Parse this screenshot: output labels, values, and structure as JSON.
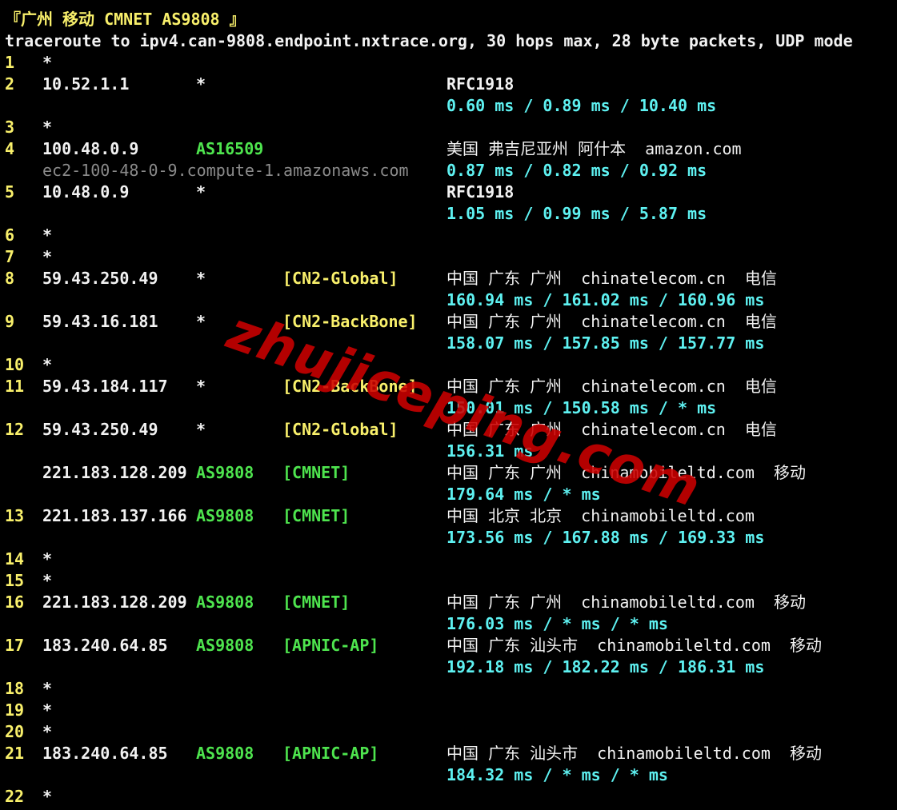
{
  "header": {
    "title": "『广州 移动 CMNET AS9808 』",
    "command": "traceroute to ipv4.can-9808.endpoint.nxtrace.org, 30 hops max, 28 byte packets, UDP mode"
  },
  "hops": [
    {
      "hop": "1",
      "ip": "*"
    },
    {
      "hop": "2",
      "ip": "10.52.1.1",
      "asn": "*",
      "geo": "RFC1918",
      "rtt": "0.60 ms / 0.89 ms / 10.40 ms"
    },
    {
      "hop": "3",
      "ip": "*"
    },
    {
      "hop": "4",
      "ip": "100.48.0.9",
      "asn": "AS16509",
      "geo": "美国 弗吉尼亚州 阿什本  amazon.com",
      "hostname": "ec2-100-48-0-9.compute-1.amazonaws.com",
      "rtt": "0.87 ms / 0.82 ms / 0.92 ms"
    },
    {
      "hop": "5",
      "ip": "10.48.0.9",
      "asn": "*",
      "geo": "RFC1918",
      "rtt": "1.05 ms / 0.99 ms / 5.87 ms"
    },
    {
      "hop": "6",
      "ip": "*"
    },
    {
      "hop": "7",
      "ip": "*"
    },
    {
      "hop": "8",
      "ip": "59.43.250.49",
      "asn": "*",
      "tag": "[CN2-Global]",
      "geo": "中国 广东 广州  chinatelecom.cn  电信",
      "rtt": "160.94 ms / 161.02 ms / 160.96 ms"
    },
    {
      "hop": "9",
      "ip": "59.43.16.181",
      "asn": "*",
      "tag": "[CN2-BackBone]",
      "geo": "中国 广东 广州  chinatelecom.cn  电信",
      "rtt": "158.07 ms / 157.85 ms / 157.77 ms"
    },
    {
      "hop": "10",
      "ip": "*"
    },
    {
      "hop": "11",
      "ip": "59.43.184.117",
      "asn": "*",
      "tag": "[CN2-BackBone]",
      "geo": "中国 广东 广州  chinatelecom.cn  电信",
      "rtt": "150.01 ms / 150.58 ms / * ms"
    },
    {
      "hop": "12",
      "ip": "59.43.250.49",
      "asn": "*",
      "tag": "[CN2-Global]",
      "geo": "中国 广东 广州  chinatelecom.cn  电信",
      "rtt": "156.31 ms"
    },
    {
      "hop": "",
      "ip": "221.183.128.209",
      "asn": "AS9808",
      "tag": "[CMNET]",
      "geo": "中国 广东 广州  chinamobileltd.com  移动",
      "rtt": "179.64 ms / * ms"
    },
    {
      "hop": "13",
      "ip": "221.183.137.166",
      "asn": "AS9808",
      "tag": "[CMNET]",
      "geo": "中国 北京 北京  chinamobileltd.com",
      "rtt": "173.56 ms / 167.88 ms / 169.33 ms"
    },
    {
      "hop": "14",
      "ip": "*"
    },
    {
      "hop": "15",
      "ip": "*"
    },
    {
      "hop": "16",
      "ip": "221.183.128.209",
      "asn": "AS9808",
      "tag": "[CMNET]",
      "geo": "中国 广东 广州  chinamobileltd.com  移动",
      "rtt": "176.03 ms / * ms / * ms"
    },
    {
      "hop": "17",
      "ip": "183.240.64.85",
      "asn": "AS9808",
      "tag": "[APNIC-AP]",
      "geo": "中国 广东 汕头市  chinamobileltd.com  移动",
      "rtt": "192.18 ms / 182.22 ms / 186.31 ms"
    },
    {
      "hop": "18",
      "ip": "*"
    },
    {
      "hop": "19",
      "ip": "*"
    },
    {
      "hop": "20",
      "ip": "*"
    },
    {
      "hop": "21",
      "ip": "183.240.64.85",
      "asn": "AS9808",
      "tag": "[APNIC-AP]",
      "geo": "中国 广东 汕头市  chinamobileltd.com  移动",
      "rtt": "184.32 ms / * ms / * ms"
    },
    {
      "hop": "22",
      "ip": "*"
    }
  ],
  "watermark": "zhujiceping.com",
  "colors": {
    "background": "#000000",
    "title": "#f9f06b",
    "hop_number": "#f9f06b",
    "asn": "#4ee44e",
    "tag": "#f9f06b",
    "rtt": "#5ef1f1",
    "hostname": "#8a8a8a",
    "watermark": "#cc0000"
  }
}
